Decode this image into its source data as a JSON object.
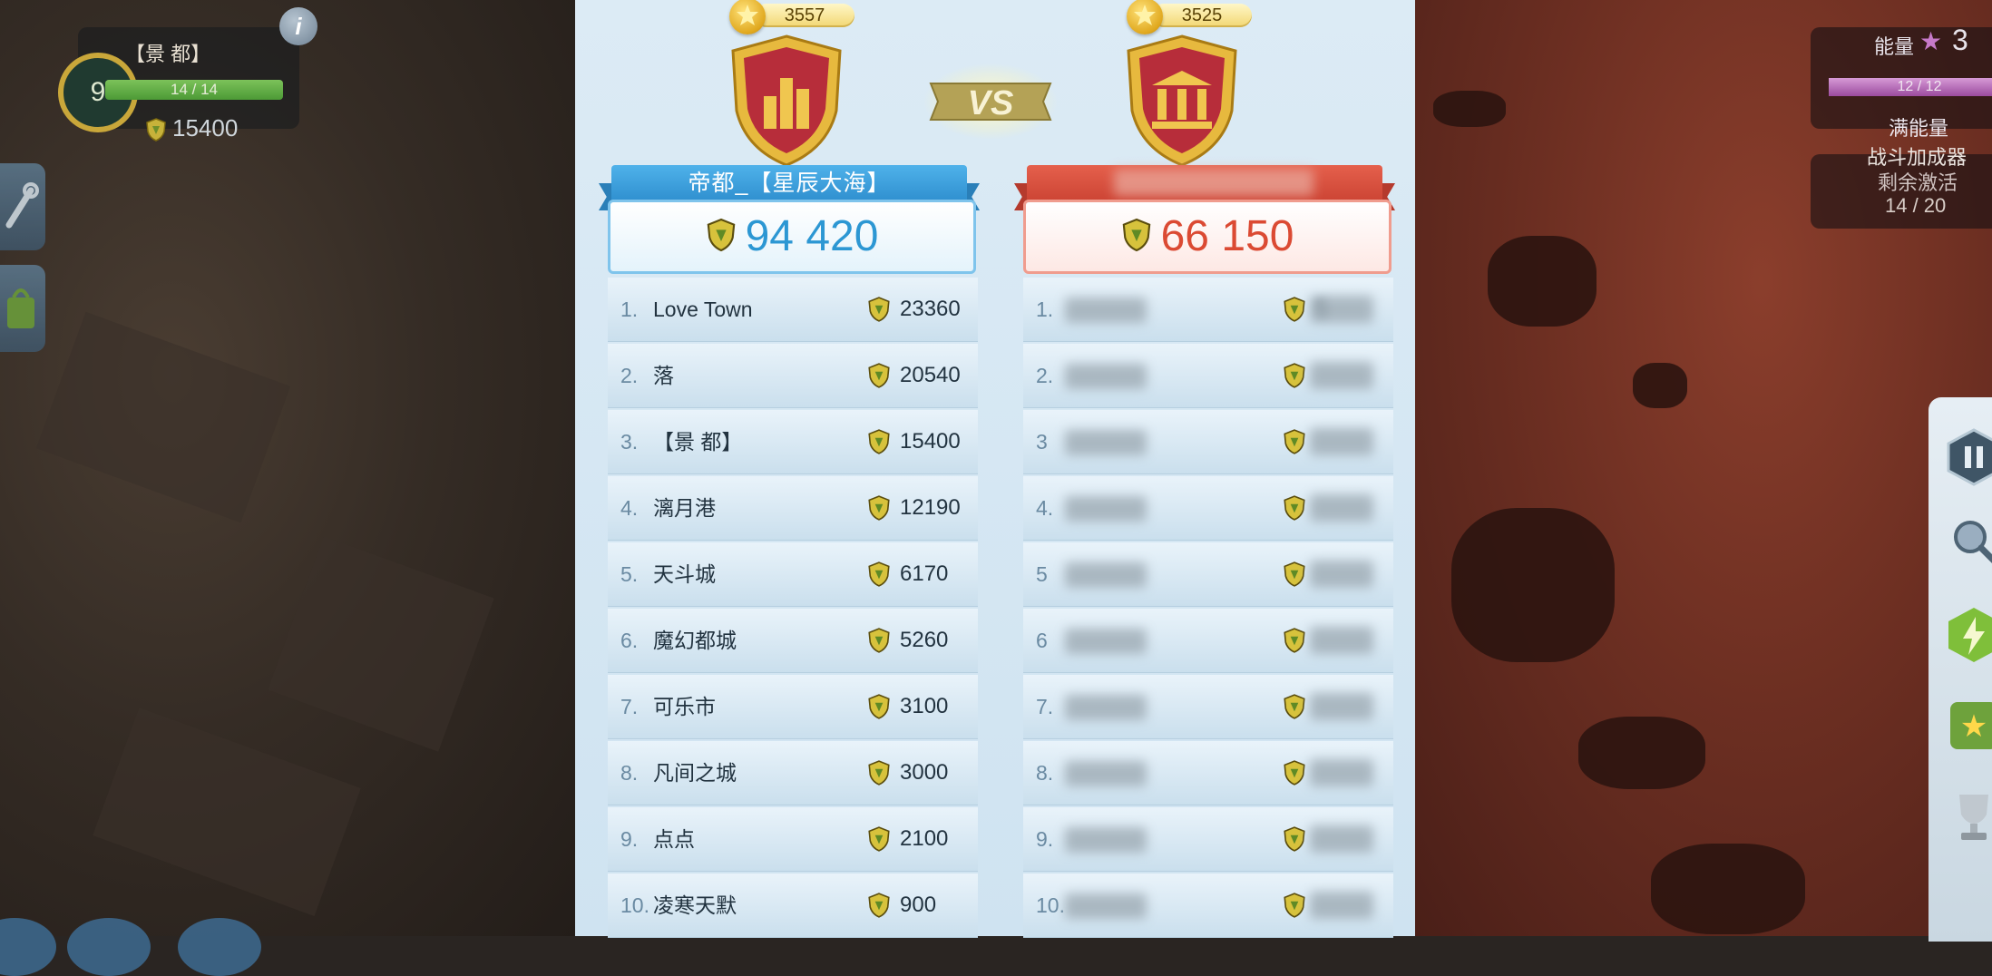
{
  "hud_left": {
    "city_name": "【景  都】",
    "level": "9",
    "bar_text": "14 / 14",
    "bar_fill_fraction": 1.0,
    "score": "15400",
    "info_icon": "info-icon"
  },
  "hud_right": {
    "energy_label": "能量",
    "energy_count": "3",
    "energy_bar_text": "12 / 12",
    "energy_fill_fraction": 1.0,
    "energy_full": "满能量",
    "booster_title": "战斗加成器",
    "booster_sub": "剩余激活",
    "booster_count": "14 / 20"
  },
  "team_left": {
    "stars": "3557",
    "name": "帝都_【星辰大海】",
    "total": "94 420",
    "color": "#3d9ad8",
    "members": [
      {
        "rank": "1.",
        "name": "Love Town",
        "points": "23360"
      },
      {
        "rank": "2.",
        "name": "落",
        "points": "20540"
      },
      {
        "rank": "3.",
        "name": "【景    都】",
        "points": "15400"
      },
      {
        "rank": "4.",
        "name": "漓月港",
        "points": "12190"
      },
      {
        "rank": "5.",
        "name": "天斗城",
        "points": "6170"
      },
      {
        "rank": "6.",
        "name": "魔幻都城",
        "points": "5260"
      },
      {
        "rank": "7.",
        "name": "可乐市",
        "points": "3100"
      },
      {
        "rank": "8.",
        "name": "凡间之城",
        "points": "3000"
      },
      {
        "rank": "9.",
        "name": "点点",
        "points": "2100"
      },
      {
        "rank": "10.",
        "name": "凌寒天默",
        "points": "900"
      }
    ]
  },
  "team_right": {
    "stars": "3525",
    "name": "",
    "total": "66 150",
    "color": "#d9503f",
    "members": [
      {
        "rank": "1.",
        "points": "5"
      },
      {
        "rank": "2.",
        "points": ""
      },
      {
        "rank": "3",
        "points": ""
      },
      {
        "rank": "4.",
        "points": ""
      },
      {
        "rank": "5",
        "points": ""
      },
      {
        "rank": "6",
        "points": ""
      },
      {
        "rank": "7.",
        "points": ""
      },
      {
        "rank": "8.",
        "points": ""
      },
      {
        "rank": "9.",
        "points": ""
      },
      {
        "rank": "10.",
        "points": ""
      }
    ]
  },
  "vs_label": "VS"
}
